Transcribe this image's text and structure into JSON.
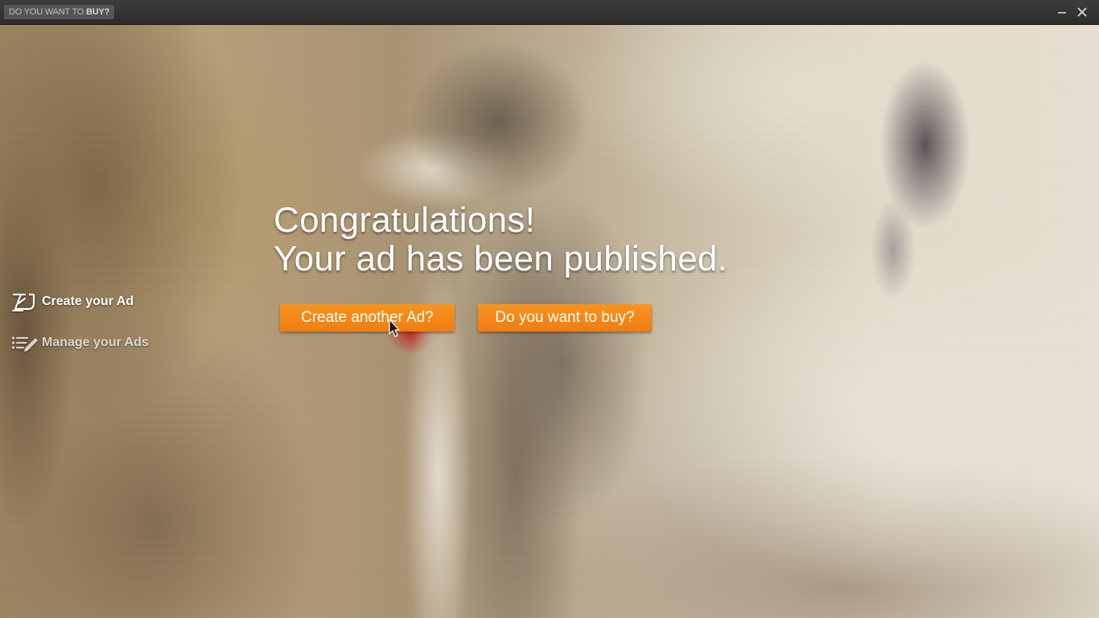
{
  "window": {
    "app_name_prefix": "DO YOU WANT TO",
    "app_name_bold": "BUY?",
    "controls": {
      "minimize_icon": "minimize-icon",
      "close_icon": "close-icon"
    }
  },
  "sidebar": {
    "items": [
      {
        "label": "Create your Ad",
        "icon": "create-ad-icon",
        "active": true
      },
      {
        "label": "Manage your Ads",
        "icon": "manage-ads-icon",
        "active": false
      }
    ]
  },
  "main": {
    "headline_line1": "Congratulations!",
    "headline_line2": "Your ad has been published.",
    "buttons": {
      "create_another": "Create another Ad?",
      "want_to_buy": "Do you want to buy?"
    }
  },
  "colors": {
    "accent": "#f7941f",
    "titlebar": "#333333",
    "text_light": "#ffffff"
  }
}
